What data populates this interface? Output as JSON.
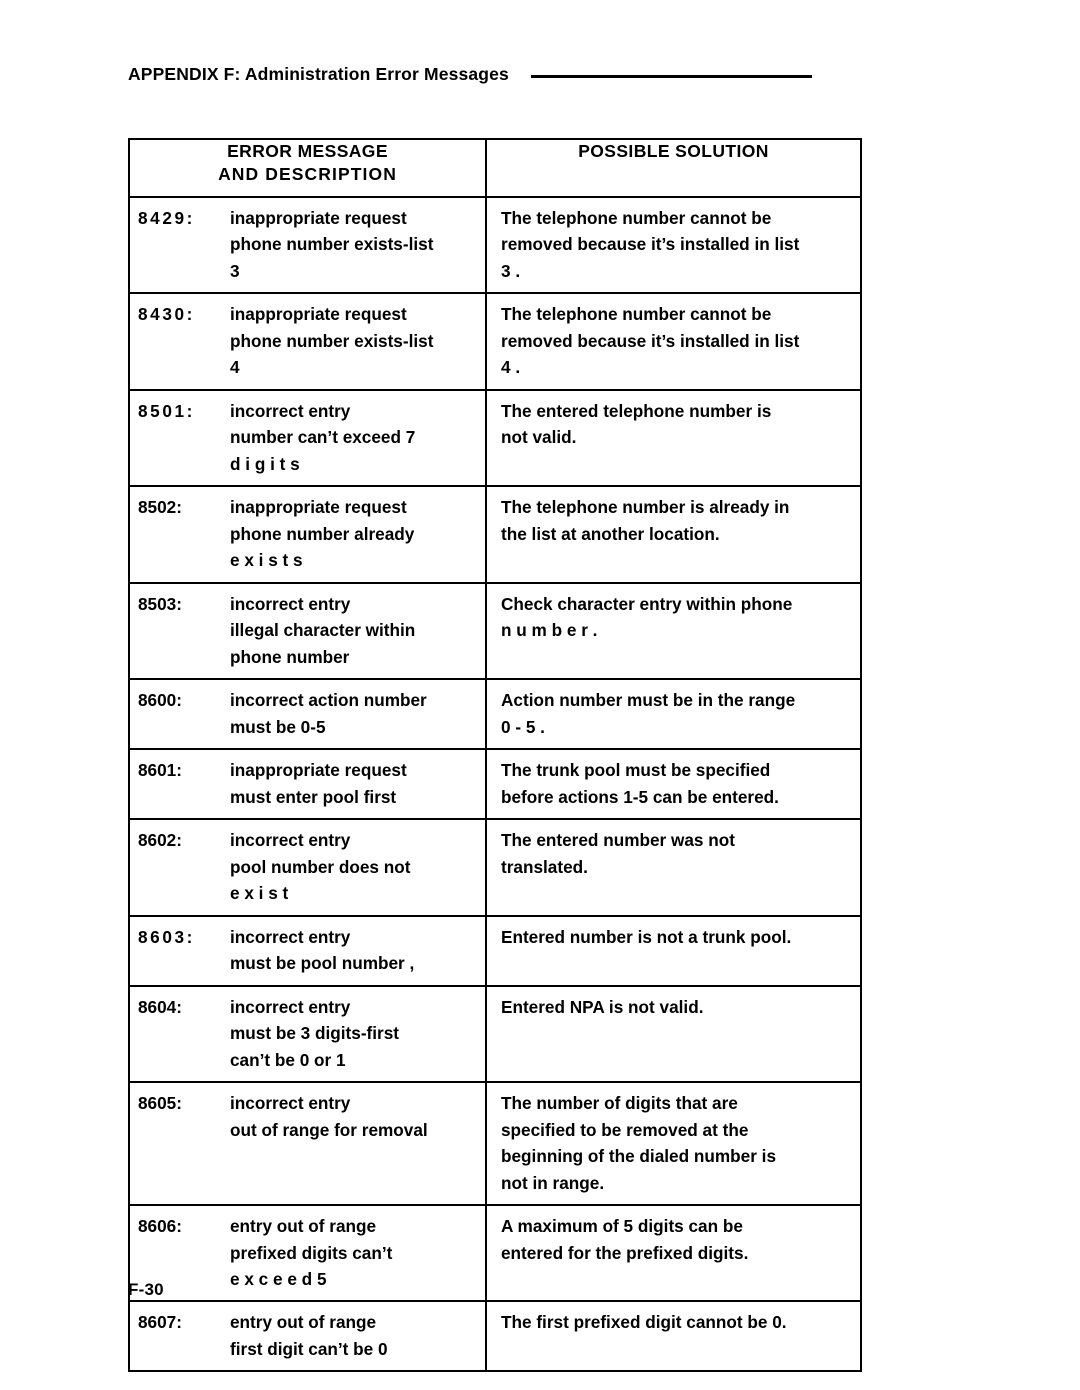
{
  "running_head": {
    "title": "APPENDIX F: Administration Error Messages",
    "rule": "horizontal-rule"
  },
  "table": {
    "headers": {
      "message_line1": "ERROR MESSAGE",
      "message_line2": "AND  DESCRIPTION",
      "solution": "POSSIBLE SOLUTION"
    },
    "rows": [
      {
        "code": "8429:",
        "message_lines": [
          "inappropriate  request",
          "phone number exists-list",
          "3"
        ],
        "solution_lines": [
          "The telephone number cannot be",
          "removed because it’s installed in list",
          "3 ."
        ]
      },
      {
        "code": "8430:",
        "message_lines": [
          "inappropriate  request",
          "phone number exists-list",
          "4"
        ],
        "solution_lines": [
          "The telephone number cannot be",
          "removed because it’s installed in list",
          "4 ."
        ]
      },
      {
        "code": "8501:",
        "message_lines": [
          "incorrect  entry",
          "number can’t exceed 7",
          "d i g i t s"
        ],
        "solution_lines": [
          "The entered telephone number is",
          "not  valid."
        ]
      },
      {
        "code": "8502:",
        "message_lines": [
          "inappropriate  request",
          "phone number already",
          "e x i s t s"
        ],
        "solution_lines": [
          "The telephone number is already in",
          "the  list at another location."
        ]
      },
      {
        "code": "8503:",
        "message_lines": [
          "incorrect  entry",
          "illegal character within",
          "phone  number"
        ],
        "solution_lines": [
          "Check character entry within phone",
          "n u m b e r ."
        ]
      },
      {
        "code": "8600:",
        "message_lines": [
          "incorrect  action  number",
          "must  be  0-5"
        ],
        "solution_lines": [
          "Action number must be in the range",
          "0 - 5 ."
        ]
      },
      {
        "code": "8601:",
        "message_lines": [
          "inappropriate  request",
          "must  enter  pool  first"
        ],
        "solution_lines": [
          "The trunk pool must be specified",
          "before actions 1-5 can be entered."
        ]
      },
      {
        "code": "8602:",
        "message_lines": [
          "incorrect  entry",
          "pool number does not",
          "e x i s t"
        ],
        "solution_lines": [
          "The entered number was not",
          "translated."
        ]
      },
      {
        "code": "8603:",
        "message_lines": [
          "incorrect  entry",
          "must be pool number ,"
        ],
        "solution_lines": [
          "Entered number is not a trunk pool."
        ]
      },
      {
        "code": "8604:",
        "message_lines": [
          "incorrect  entry",
          "must be 3 digits-first",
          "can’t be 0 or 1"
        ],
        "solution_lines": [
          "Entered NPA is not valid."
        ]
      },
      {
        "code": "8605:",
        "message_lines": [
          "incorrect  entry",
          "out of range for removal"
        ],
        "solution_lines": [
          "The number of digits that are",
          "specified to be removed at the",
          "beginning of the dialed number is",
          "not  in  range."
        ]
      },
      {
        "code": "8606:",
        "message_lines": [
          "entry out of range",
          "prefixed  digits  can’t",
          "e x c e e d   5"
        ],
        "solution_lines": [
          "A maximum of 5 digits can be",
          "entered for the prefixed digits."
        ]
      },
      {
        "code": "8607:",
        "message_lines": [
          "entry  out  of  range",
          "first digit can’t be 0"
        ],
        "solution_lines": [
          "The first prefixed digit cannot be 0."
        ]
      }
    ]
  },
  "folio": "F-30"
}
